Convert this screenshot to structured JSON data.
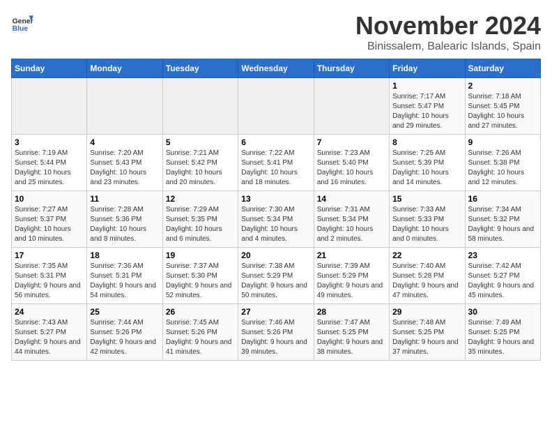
{
  "logo": {
    "text_general": "General",
    "text_blue": "Blue"
  },
  "title": "November 2024",
  "subtitle": "Binissalem, Balearic Islands, Spain",
  "days_of_week": [
    "Sunday",
    "Monday",
    "Tuesday",
    "Wednesday",
    "Thursday",
    "Friday",
    "Saturday"
  ],
  "weeks": [
    [
      {
        "day": "",
        "sunrise": "",
        "sunset": "",
        "daylight": ""
      },
      {
        "day": "",
        "sunrise": "",
        "sunset": "",
        "daylight": ""
      },
      {
        "day": "",
        "sunrise": "",
        "sunset": "",
        "daylight": ""
      },
      {
        "day": "",
        "sunrise": "",
        "sunset": "",
        "daylight": ""
      },
      {
        "day": "",
        "sunrise": "",
        "sunset": "",
        "daylight": ""
      },
      {
        "day": "1",
        "sunrise": "Sunrise: 7:17 AM",
        "sunset": "Sunset: 5:47 PM",
        "daylight": "Daylight: 10 hours and 29 minutes."
      },
      {
        "day": "2",
        "sunrise": "Sunrise: 7:18 AM",
        "sunset": "Sunset: 5:45 PM",
        "daylight": "Daylight: 10 hours and 27 minutes."
      }
    ],
    [
      {
        "day": "3",
        "sunrise": "Sunrise: 7:19 AM",
        "sunset": "Sunset: 5:44 PM",
        "daylight": "Daylight: 10 hours and 25 minutes."
      },
      {
        "day": "4",
        "sunrise": "Sunrise: 7:20 AM",
        "sunset": "Sunset: 5:43 PM",
        "daylight": "Daylight: 10 hours and 23 minutes."
      },
      {
        "day": "5",
        "sunrise": "Sunrise: 7:21 AM",
        "sunset": "Sunset: 5:42 PM",
        "daylight": "Daylight: 10 hours and 20 minutes."
      },
      {
        "day": "6",
        "sunrise": "Sunrise: 7:22 AM",
        "sunset": "Sunset: 5:41 PM",
        "daylight": "Daylight: 10 hours and 18 minutes."
      },
      {
        "day": "7",
        "sunrise": "Sunrise: 7:23 AM",
        "sunset": "Sunset: 5:40 PM",
        "daylight": "Daylight: 10 hours and 16 minutes."
      },
      {
        "day": "8",
        "sunrise": "Sunrise: 7:25 AM",
        "sunset": "Sunset: 5:39 PM",
        "daylight": "Daylight: 10 hours and 14 minutes."
      },
      {
        "day": "9",
        "sunrise": "Sunrise: 7:26 AM",
        "sunset": "Sunset: 5:38 PM",
        "daylight": "Daylight: 10 hours and 12 minutes."
      }
    ],
    [
      {
        "day": "10",
        "sunrise": "Sunrise: 7:27 AM",
        "sunset": "Sunset: 5:37 PM",
        "daylight": "Daylight: 10 hours and 10 minutes."
      },
      {
        "day": "11",
        "sunrise": "Sunrise: 7:28 AM",
        "sunset": "Sunset: 5:36 PM",
        "daylight": "Daylight: 10 hours and 8 minutes."
      },
      {
        "day": "12",
        "sunrise": "Sunrise: 7:29 AM",
        "sunset": "Sunset: 5:35 PM",
        "daylight": "Daylight: 10 hours and 6 minutes."
      },
      {
        "day": "13",
        "sunrise": "Sunrise: 7:30 AM",
        "sunset": "Sunset: 5:34 PM",
        "daylight": "Daylight: 10 hours and 4 minutes."
      },
      {
        "day": "14",
        "sunrise": "Sunrise: 7:31 AM",
        "sunset": "Sunset: 5:34 PM",
        "daylight": "Daylight: 10 hours and 2 minutes."
      },
      {
        "day": "15",
        "sunrise": "Sunrise: 7:33 AM",
        "sunset": "Sunset: 5:33 PM",
        "daylight": "Daylight: 10 hours and 0 minutes."
      },
      {
        "day": "16",
        "sunrise": "Sunrise: 7:34 AM",
        "sunset": "Sunset: 5:32 PM",
        "daylight": "Daylight: 9 hours and 58 minutes."
      }
    ],
    [
      {
        "day": "17",
        "sunrise": "Sunrise: 7:35 AM",
        "sunset": "Sunset: 5:31 PM",
        "daylight": "Daylight: 9 hours and 56 minutes."
      },
      {
        "day": "18",
        "sunrise": "Sunrise: 7:36 AM",
        "sunset": "Sunset: 5:31 PM",
        "daylight": "Daylight: 9 hours and 54 minutes."
      },
      {
        "day": "19",
        "sunrise": "Sunrise: 7:37 AM",
        "sunset": "Sunset: 5:30 PM",
        "daylight": "Daylight: 9 hours and 52 minutes."
      },
      {
        "day": "20",
        "sunrise": "Sunrise: 7:38 AM",
        "sunset": "Sunset: 5:29 PM",
        "daylight": "Daylight: 9 hours and 50 minutes."
      },
      {
        "day": "21",
        "sunrise": "Sunrise: 7:39 AM",
        "sunset": "Sunset: 5:29 PM",
        "daylight": "Daylight: 9 hours and 49 minutes."
      },
      {
        "day": "22",
        "sunrise": "Sunrise: 7:40 AM",
        "sunset": "Sunset: 5:28 PM",
        "daylight": "Daylight: 9 hours and 47 minutes."
      },
      {
        "day": "23",
        "sunrise": "Sunrise: 7:42 AM",
        "sunset": "Sunset: 5:27 PM",
        "daylight": "Daylight: 9 hours and 45 minutes."
      }
    ],
    [
      {
        "day": "24",
        "sunrise": "Sunrise: 7:43 AM",
        "sunset": "Sunset: 5:27 PM",
        "daylight": "Daylight: 9 hours and 44 minutes."
      },
      {
        "day": "25",
        "sunrise": "Sunrise: 7:44 AM",
        "sunset": "Sunset: 5:26 PM",
        "daylight": "Daylight: 9 hours and 42 minutes."
      },
      {
        "day": "26",
        "sunrise": "Sunrise: 7:45 AM",
        "sunset": "Sunset: 5:26 PM",
        "daylight": "Daylight: 9 hours and 41 minutes."
      },
      {
        "day": "27",
        "sunrise": "Sunrise: 7:46 AM",
        "sunset": "Sunset: 5:26 PM",
        "daylight": "Daylight: 9 hours and 39 minutes."
      },
      {
        "day": "28",
        "sunrise": "Sunrise: 7:47 AM",
        "sunset": "Sunset: 5:25 PM",
        "daylight": "Daylight: 9 hours and 38 minutes."
      },
      {
        "day": "29",
        "sunrise": "Sunrise: 7:48 AM",
        "sunset": "Sunset: 5:25 PM",
        "daylight": "Daylight: 9 hours and 37 minutes."
      },
      {
        "day": "30",
        "sunrise": "Sunrise: 7:49 AM",
        "sunset": "Sunset: 5:25 PM",
        "daylight": "Daylight: 9 hours and 35 minutes."
      }
    ]
  ]
}
